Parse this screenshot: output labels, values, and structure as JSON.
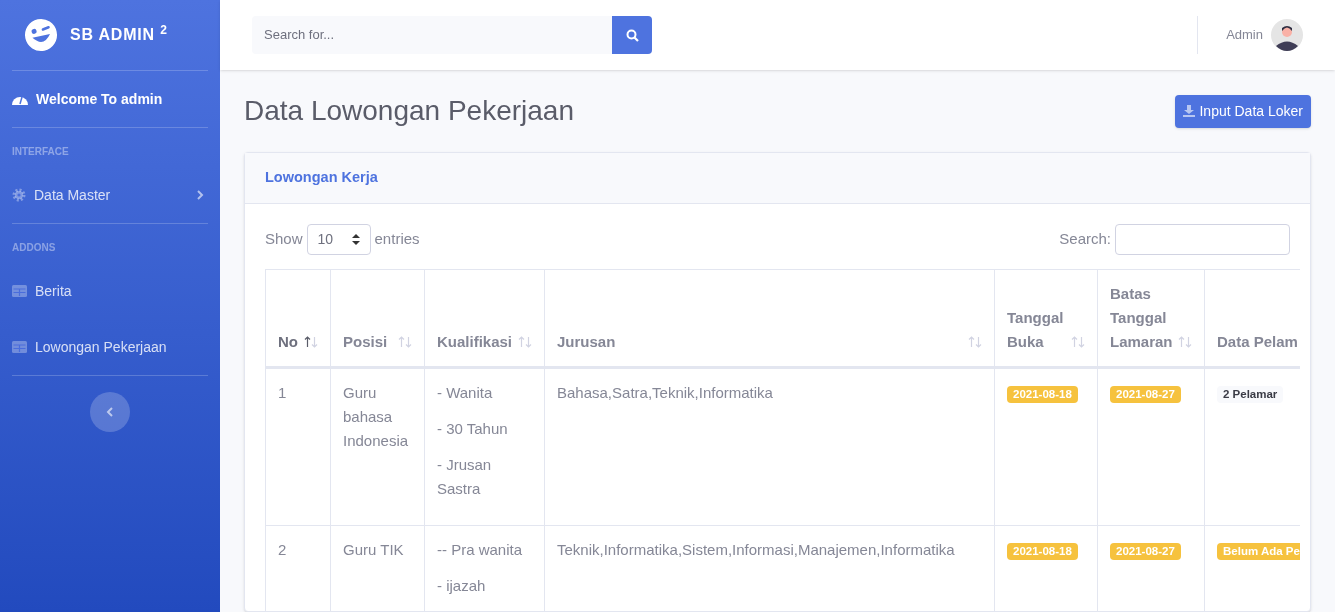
{
  "sidebar": {
    "brand": "SB ADMIN",
    "brand_sup": "2",
    "items": [
      {
        "kind": "link",
        "label": "Welcome To admin",
        "active": true
      },
      {
        "kind": "heading",
        "label": "INTERFACE"
      },
      {
        "kind": "link",
        "label": "Data Master",
        "active": false,
        "expandable": true
      },
      {
        "kind": "heading",
        "label": "ADDONS"
      },
      {
        "kind": "link",
        "label": "Berita",
        "active": false
      },
      {
        "kind": "link",
        "label": "Lowongan Pekerjaan",
        "active": false
      }
    ]
  },
  "topbar": {
    "search": {
      "placeholder": "Search for..."
    },
    "user": "Admin"
  },
  "page": {
    "title": "Data Lowongan Pekerjaan",
    "action_button": "Input Data Loker"
  },
  "card": {
    "title": "Lowongan Kerja",
    "show_label": "Show",
    "page_size": "10",
    "entries_label": "entries",
    "search_label": "Search:",
    "table": {
      "columns": [
        {
          "label": "No",
          "sortable": true,
          "sorted": true
        },
        {
          "label": "Posisi",
          "sortable": true,
          "sorted": false
        },
        {
          "label": "Kualifikasi",
          "sortable": true,
          "sorted": false
        },
        {
          "label": "Jurusan",
          "sortable": true,
          "sorted": false
        },
        {
          "label": "Tanggal Buka",
          "sortable": true,
          "sorted": false
        },
        {
          "label": "Batas Tanggal Lamaran",
          "sortable": true,
          "sorted": false
        },
        {
          "label": "Data Pelam",
          "sortable": false
        }
      ],
      "rows": [
        {
          "no": "1",
          "posisi": "Guru bahasa Indonesia",
          "kualifikasi": [
            "- Wanita",
            "- 30 Tahun",
            "- Jrusan Sastra"
          ],
          "jurusan": "Bahasa,Satra,Teknik,Informatika",
          "tanggal_buka": "2021-08-18",
          "batas": "2021-08-27",
          "pelamar": {
            "kind": "light",
            "text": "2 Pelamar"
          }
        },
        {
          "no": "2",
          "posisi": "Guru TIK",
          "kualifikasi": [
            "-- Pra wanita",
            "- ijazah"
          ],
          "jurusan": "Teknik,Informatika,Sistem,Informasi,Manajemen,Informatika",
          "tanggal_buka": "2021-08-18",
          "batas": "2021-08-27",
          "pelamar": {
            "kind": "warning",
            "text": "Belum Ada Pe"
          }
        }
      ]
    }
  }
}
